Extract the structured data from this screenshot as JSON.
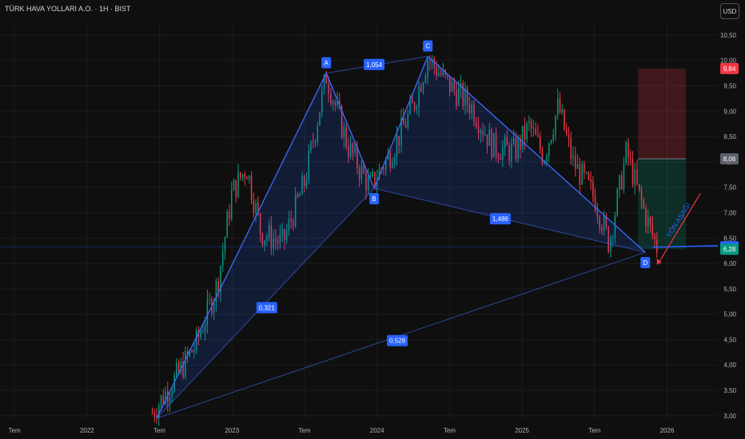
{
  "header": {
    "title": "TÜRK HAVA YOLLARI A.O. · 1H · BIST",
    "currency_button": "USD"
  },
  "chart_data": {
    "type": "candlestick",
    "ylim": [
      2.95,
      10.75
    ],
    "y_ticks": [
      "3,00",
      "3,50",
      "4,00",
      "4,50",
      "5,00",
      "5,50",
      "6,00",
      "6,50",
      "7,00",
      "7,50",
      "8,00",
      "8,50",
      "9,00",
      "9,50",
      "10,00",
      "10,50"
    ],
    "x_ticks": [
      {
        "label": "Tem",
        "t": 2021.5
      },
      {
        "label": "2022",
        "t": 2022.0
      },
      {
        "label": "Tem",
        "t": 2022.5
      },
      {
        "label": "2023",
        "t": 2023.0
      },
      {
        "label": "Tem",
        "t": 2023.5
      },
      {
        "label": "2024",
        "t": 2024.0
      },
      {
        "label": "Tem",
        "t": 2024.5
      },
      {
        "label": "2025",
        "t": 2025.0
      },
      {
        "label": "Tem",
        "t": 2025.5
      },
      {
        "label": "2026",
        "t": 2026.0
      }
    ],
    "xlim": [
      2021.4,
      2026.35
    ],
    "price_path": [
      [
        2022.45,
        3.05
      ],
      [
        2022.6,
        3.7
      ],
      [
        2022.75,
        4.4
      ],
      [
        2022.9,
        5.6
      ],
      [
        2023.0,
        7.4
      ],
      [
        2023.1,
        7.9
      ],
      [
        2023.2,
        6.6
      ],
      [
        2023.35,
        6.4
      ],
      [
        2023.5,
        7.6
      ],
      [
        2023.65,
        9.7
      ],
      [
        2023.8,
        8.3
      ],
      [
        2023.95,
        7.5
      ],
      [
        2024.1,
        8.2
      ],
      [
        2024.25,
        9.1
      ],
      [
        2024.35,
        10.05
      ],
      [
        2024.5,
        9.5
      ],
      [
        2024.65,
        9.1
      ],
      [
        2024.8,
        8.3
      ],
      [
        2024.95,
        8.2
      ],
      [
        2025.05,
        8.7
      ],
      [
        2025.15,
        8.1
      ],
      [
        2025.25,
        9.1
      ],
      [
        2025.35,
        8.0
      ],
      [
        2025.5,
        7.3
      ],
      [
        2025.6,
        6.4
      ],
      [
        2025.68,
        7.6
      ],
      [
        2025.72,
        8.2
      ],
      [
        2025.8,
        7.4
      ],
      [
        2025.88,
        6.7
      ],
      [
        2025.93,
        6.33
      ]
    ],
    "pattern": {
      "points": [
        {
          "label": "A",
          "t": 2023.65,
          "v": 9.75
        },
        {
          "label": "B",
          "t": 2023.98,
          "v": 7.48
        },
        {
          "label": "C",
          "t": 2024.35,
          "v": 10.08
        },
        {
          "label": "D",
          "t": 2025.85,
          "v": 6.22
        }
      ],
      "start": {
        "t": 2022.48,
        "v": 2.95
      },
      "ratios": [
        {
          "text": "1,054",
          "t": 2023.98,
          "v": 9.92
        },
        {
          "text": "0,321",
          "t": 2023.24,
          "v": 5.13
        },
        {
          "text": "1,486",
          "t": 2024.85,
          "v": 6.88
        },
        {
          "text": "0,528",
          "t": 2024.14,
          "v": 4.48
        }
      ]
    },
    "position": {
      "entry": 8.06,
      "target_top": 9.84,
      "stop": 6.28,
      "t_start": 2025.8,
      "t_end": 2026.13
    },
    "annotation": {
      "text": "YÖN AŞAĞI"
    },
    "price_labels": [
      {
        "text": "9,84",
        "v": 9.84,
        "color": "#f23645"
      },
      {
        "text": "8,06",
        "v": 8.06,
        "color": "#5d606b"
      },
      {
        "text": "6,33",
        "v": 6.33,
        "color": "#2962ff"
      },
      {
        "text": "6,28",
        "v": 6.28,
        "color": "#089981"
      }
    ],
    "colors": {
      "up": "#089981",
      "down": "#f23645",
      "pattern_line": "#3d6cff",
      "pattern_fill": "#1a2a5c",
      "background": "#0f0f0f"
    }
  }
}
